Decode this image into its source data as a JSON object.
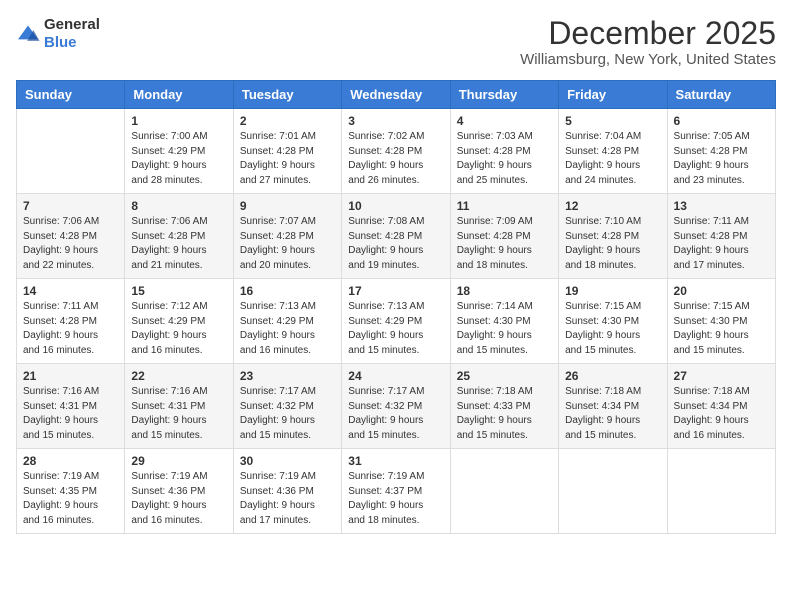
{
  "logo": {
    "general": "General",
    "blue": "Blue"
  },
  "header": {
    "month": "December 2025",
    "location": "Williamsburg, New York, United States"
  },
  "weekdays": [
    "Sunday",
    "Monday",
    "Tuesday",
    "Wednesday",
    "Thursday",
    "Friday",
    "Saturday"
  ],
  "weeks": [
    [
      {
        "day": "",
        "info": ""
      },
      {
        "day": "1",
        "info": "Sunrise: 7:00 AM\nSunset: 4:29 PM\nDaylight: 9 hours\nand 28 minutes."
      },
      {
        "day": "2",
        "info": "Sunrise: 7:01 AM\nSunset: 4:28 PM\nDaylight: 9 hours\nand 27 minutes."
      },
      {
        "day": "3",
        "info": "Sunrise: 7:02 AM\nSunset: 4:28 PM\nDaylight: 9 hours\nand 26 minutes."
      },
      {
        "day": "4",
        "info": "Sunrise: 7:03 AM\nSunset: 4:28 PM\nDaylight: 9 hours\nand 25 minutes."
      },
      {
        "day": "5",
        "info": "Sunrise: 7:04 AM\nSunset: 4:28 PM\nDaylight: 9 hours\nand 24 minutes."
      },
      {
        "day": "6",
        "info": "Sunrise: 7:05 AM\nSunset: 4:28 PM\nDaylight: 9 hours\nand 23 minutes."
      }
    ],
    [
      {
        "day": "7",
        "info": "Sunrise: 7:06 AM\nSunset: 4:28 PM\nDaylight: 9 hours\nand 22 minutes."
      },
      {
        "day": "8",
        "info": "Sunrise: 7:06 AM\nSunset: 4:28 PM\nDaylight: 9 hours\nand 21 minutes."
      },
      {
        "day": "9",
        "info": "Sunrise: 7:07 AM\nSunset: 4:28 PM\nDaylight: 9 hours\nand 20 minutes."
      },
      {
        "day": "10",
        "info": "Sunrise: 7:08 AM\nSunset: 4:28 PM\nDaylight: 9 hours\nand 19 minutes."
      },
      {
        "day": "11",
        "info": "Sunrise: 7:09 AM\nSunset: 4:28 PM\nDaylight: 9 hours\nand 18 minutes."
      },
      {
        "day": "12",
        "info": "Sunrise: 7:10 AM\nSunset: 4:28 PM\nDaylight: 9 hours\nand 18 minutes."
      },
      {
        "day": "13",
        "info": "Sunrise: 7:11 AM\nSunset: 4:28 PM\nDaylight: 9 hours\nand 17 minutes."
      }
    ],
    [
      {
        "day": "14",
        "info": "Sunrise: 7:11 AM\nSunset: 4:28 PM\nDaylight: 9 hours\nand 16 minutes."
      },
      {
        "day": "15",
        "info": "Sunrise: 7:12 AM\nSunset: 4:29 PM\nDaylight: 9 hours\nand 16 minutes."
      },
      {
        "day": "16",
        "info": "Sunrise: 7:13 AM\nSunset: 4:29 PM\nDaylight: 9 hours\nand 16 minutes."
      },
      {
        "day": "17",
        "info": "Sunrise: 7:13 AM\nSunset: 4:29 PM\nDaylight: 9 hours\nand 15 minutes."
      },
      {
        "day": "18",
        "info": "Sunrise: 7:14 AM\nSunset: 4:30 PM\nDaylight: 9 hours\nand 15 minutes."
      },
      {
        "day": "19",
        "info": "Sunrise: 7:15 AM\nSunset: 4:30 PM\nDaylight: 9 hours\nand 15 minutes."
      },
      {
        "day": "20",
        "info": "Sunrise: 7:15 AM\nSunset: 4:30 PM\nDaylight: 9 hours\nand 15 minutes."
      }
    ],
    [
      {
        "day": "21",
        "info": "Sunrise: 7:16 AM\nSunset: 4:31 PM\nDaylight: 9 hours\nand 15 minutes."
      },
      {
        "day": "22",
        "info": "Sunrise: 7:16 AM\nSunset: 4:31 PM\nDaylight: 9 hours\nand 15 minutes."
      },
      {
        "day": "23",
        "info": "Sunrise: 7:17 AM\nSunset: 4:32 PM\nDaylight: 9 hours\nand 15 minutes."
      },
      {
        "day": "24",
        "info": "Sunrise: 7:17 AM\nSunset: 4:32 PM\nDaylight: 9 hours\nand 15 minutes."
      },
      {
        "day": "25",
        "info": "Sunrise: 7:18 AM\nSunset: 4:33 PM\nDaylight: 9 hours\nand 15 minutes."
      },
      {
        "day": "26",
        "info": "Sunrise: 7:18 AM\nSunset: 4:34 PM\nDaylight: 9 hours\nand 15 minutes."
      },
      {
        "day": "27",
        "info": "Sunrise: 7:18 AM\nSunset: 4:34 PM\nDaylight: 9 hours\nand 16 minutes."
      }
    ],
    [
      {
        "day": "28",
        "info": "Sunrise: 7:19 AM\nSunset: 4:35 PM\nDaylight: 9 hours\nand 16 minutes."
      },
      {
        "day": "29",
        "info": "Sunrise: 7:19 AM\nSunset: 4:36 PM\nDaylight: 9 hours\nand 16 minutes."
      },
      {
        "day": "30",
        "info": "Sunrise: 7:19 AM\nSunset: 4:36 PM\nDaylight: 9 hours\nand 17 minutes."
      },
      {
        "day": "31",
        "info": "Sunrise: 7:19 AM\nSunset: 4:37 PM\nDaylight: 9 hours\nand 18 minutes."
      },
      {
        "day": "",
        "info": ""
      },
      {
        "day": "",
        "info": ""
      },
      {
        "day": "",
        "info": ""
      }
    ]
  ]
}
